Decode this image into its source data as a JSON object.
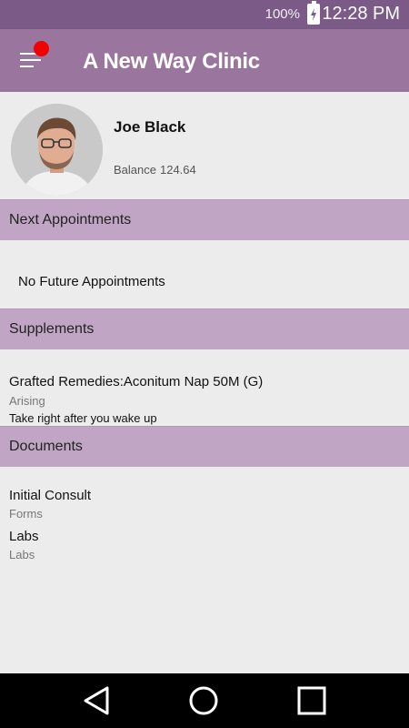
{
  "status_bar": {
    "battery_percent": "100%",
    "time": "12:28 PM"
  },
  "app_bar": {
    "title": "A New Way Clinic",
    "menu_icon": "hamburger-menu-icon",
    "notification_color": "#f20000"
  },
  "profile": {
    "name": "Joe Black",
    "balance_label": "Balance",
    "balance_value": "124.64"
  },
  "next_appointments": {
    "header": "Next Appointments",
    "empty_message": "No Future Appointments"
  },
  "supplements": {
    "header": "Supplements",
    "items": [
      {
        "name": "Grafted Remedies:Aconitum Nap 50M (G)",
        "timing": "Arising",
        "instructions": "Take right after you wake up"
      }
    ]
  },
  "documents": {
    "header": "Documents",
    "items": [
      {
        "title": "Initial Consult",
        "category": "Forms"
      },
      {
        "title": "Labs",
        "category": "Labs"
      }
    ]
  },
  "colors": {
    "status_bar": "#7b5a88",
    "app_bar": "#9a769f",
    "section_header": "#c0a6c4",
    "background": "#ececec"
  },
  "nav_bar": {
    "icons": [
      "back-triangle-icon",
      "home-circle-icon",
      "recents-square-icon"
    ]
  }
}
